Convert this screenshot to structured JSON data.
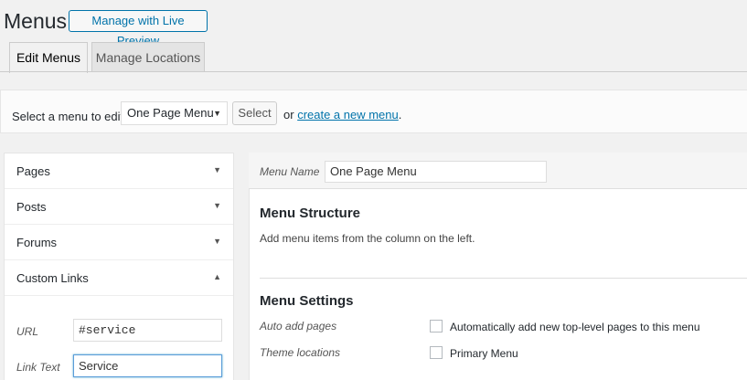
{
  "header": {
    "title": "Menus",
    "live_preview_label": "Manage with Live Preview"
  },
  "tabs": [
    {
      "label": "Edit Menus",
      "active": true
    },
    {
      "label": "Manage Locations",
      "active": false
    }
  ],
  "menu_select": {
    "label": "Select a menu to edit:",
    "selected": "One Page Menu",
    "select_button": "Select",
    "or_text": "or",
    "create_link": "create a new menu",
    "period": "."
  },
  "sidebar": {
    "items": [
      {
        "label": "Pages",
        "expanded": false
      },
      {
        "label": "Posts",
        "expanded": false
      },
      {
        "label": "Forums",
        "expanded": false
      },
      {
        "label": "Custom Links",
        "expanded": true
      }
    ],
    "custom_links": {
      "url_label": "URL",
      "url_value": "#service",
      "link_text_label": "Link Text",
      "link_text_value": "Service"
    }
  },
  "menu_editor": {
    "name_label": "Menu Name",
    "name_value": "One Page Menu",
    "structure_heading": "Menu Structure",
    "structure_desc": "Add menu items from the column on the left.",
    "settings_heading": "Menu Settings",
    "settings": [
      {
        "label": "Auto add pages",
        "option": "Automatically add new top-level pages to this menu",
        "checked": false
      },
      {
        "label": "Theme locations",
        "option": "Primary Menu",
        "checked": false
      }
    ]
  },
  "colors": {
    "link": "#0073aa",
    "background": "#f1f1f1",
    "focus": "#5b9dd9"
  }
}
